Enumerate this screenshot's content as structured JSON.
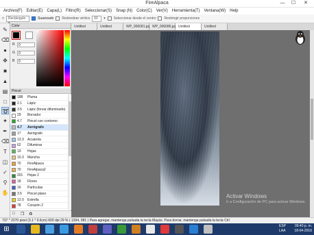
{
  "window": {
    "title": "FireAlpaca",
    "min": "—",
    "max": "☐",
    "close": "✕"
  },
  "menu": [
    "Archivo(F)",
    "Editar(E)",
    "Capa(L)",
    "Filtro(R)",
    "Seleccionar(S)",
    "Snap (N)",
    "Color(C)",
    "Ver(V)",
    "Herramienta(T)",
    "Ventana(W)",
    "Help"
  ],
  "toolbar": {
    "shape_select": "Rectángulo",
    "antialias_label": "Suavizado",
    "antialias_checked": true,
    "round_corner_label": "Redondear vértice",
    "round_corner_value": "60",
    "from_center_label": "Seleccionar desde el centro",
    "restrict_label": "Restringir proporciones"
  },
  "color_panel": {
    "title": "Color",
    "r_label": "R",
    "r_value": "0",
    "g_label": "G",
    "g_value": "0",
    "b_label": "B",
    "b_value": "0",
    "fg_color": "#000000",
    "bg_color": "#ffffff"
  },
  "pen_panel": {
    "title": "Pincel",
    "brushes": [
      {
        "size": "188",
        "name": "Pluma",
        "color": "#111111"
      },
      {
        "size": "2.1",
        "name": "Lápiz",
        "color": "#222222"
      },
      {
        "size": "3.5",
        "name": "Lápiz (forzar difuminado)",
        "color": "#333333"
      },
      {
        "size": "29",
        "name": "Borrador",
        "color": "#ffffff"
      },
      {
        "size": "4.7",
        "name": "Pincel con contorno",
        "color": "#22aa22"
      },
      {
        "size": "4.7",
        "name": "Aerógrafo",
        "color": "#bfbfbf",
        "selected": true
      },
      {
        "size": "17",
        "name": "Aerógrafo",
        "color": "#a0a0a0"
      },
      {
        "size": "13.3",
        "name": "Acuarela",
        "color": "#9fc6ee"
      },
      {
        "size": "62",
        "name": "Difuminar",
        "color": "#c9a0e8"
      },
      {
        "size": "19",
        "name": "Hojas",
        "color": "#55bb55"
      },
      {
        "size": "10.3",
        "name": "Mancha",
        "color": "#e8c87a"
      },
      {
        "size": "70",
        "name": "FireAlpaca",
        "color": "#f0a030"
      },
      {
        "size": "70",
        "name": "FireAlpaca2",
        "color": "#f0b040"
      },
      {
        "size": "201",
        "name": "Hojas 2",
        "color": "#2e8b3d"
      },
      {
        "size": "18",
        "name": "Flores",
        "color": "#e060a0"
      },
      {
        "size": "16",
        "name": "Partículas",
        "color": "#4060d0"
      },
      {
        "size": "3.5",
        "name": "Pincel plano",
        "color": "#777777"
      },
      {
        "size": "12.0",
        "name": "Estrella",
        "color": "#e8d020"
      },
      {
        "size": "78",
        "name": "Corazón 2",
        "color": "#e03a3a"
      }
    ]
  },
  "tabs": [
    {
      "label": "Untitled",
      "active": false
    },
    {
      "label": "Untitled",
      "active": false
    },
    {
      "label": "WP_006081.jpg",
      "active": false
    },
    {
      "label": "WP_006086.jpg",
      "active": false
    },
    {
      "label": "Untitled",
      "active": true
    },
    {
      "label": "Untitled",
      "active": false
    }
  ],
  "watermark": {
    "line1": "Activar Windows",
    "line2": "Ir a Configuración de PC para activar Windows."
  },
  "status": "737 * 2270 pixel  (3.1 * 9.6cm)  600 dpi  29 %  ( 1394, 981 )  Para agregar, mantenga pulsada la tecla Mayús. Para borrar, mantenga pulsada la tecla Ctrl",
  "taskbar": {
    "lang": "ESP\nLAA",
    "time": "09:40 p. m.",
    "date": "18-04-2016"
  }
}
